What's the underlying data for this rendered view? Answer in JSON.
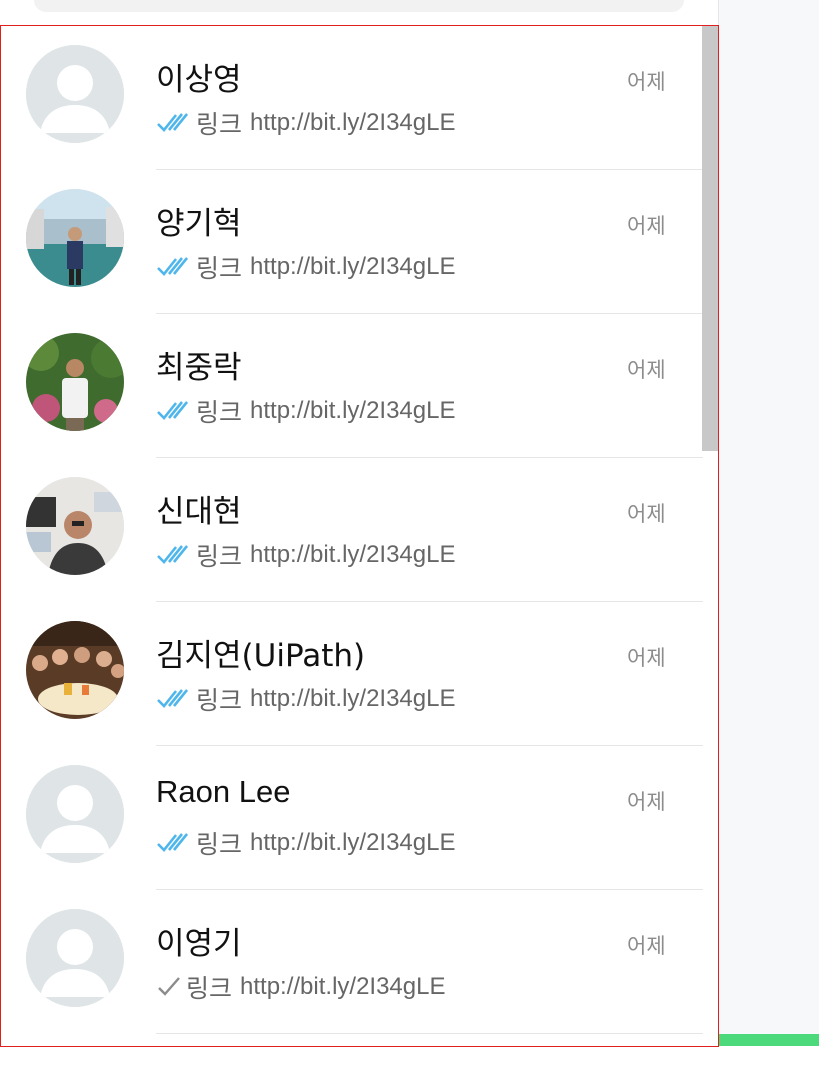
{
  "chat_list": {
    "items": [
      {
        "name": "이상영",
        "time": "어제",
        "preview_label": "링크",
        "preview_url": "http://bit.ly/2I34gLE",
        "status": "read",
        "avatar": "default-avatar"
      },
      {
        "name": "양기혁",
        "time": "어제",
        "preview_label": "링크",
        "preview_url": "http://bit.ly/2I34gLE",
        "status": "read",
        "avatar": "photo-avatar"
      },
      {
        "name": "최중락",
        "time": "어제",
        "preview_label": "링크",
        "preview_url": "http://bit.ly/2I34gLE",
        "status": "read",
        "avatar": "photo-avatar"
      },
      {
        "name": "신대현",
        "time": "어제",
        "preview_label": "링크",
        "preview_url": "http://bit.ly/2I34gLE",
        "status": "read",
        "avatar": "photo-avatar"
      },
      {
        "name": "김지연(UiPath)",
        "time": "어제",
        "preview_label": "링크",
        "preview_url": "http://bit.ly/2I34gLE",
        "status": "read",
        "avatar": "photo-avatar"
      },
      {
        "name": "Raon Lee",
        "time": "어제",
        "preview_label": "링크",
        "preview_url": "http://bit.ly/2I34gLE",
        "status": "read",
        "avatar": "default-avatar"
      },
      {
        "name": "이영기",
        "time": "어제",
        "preview_label": "링크",
        "preview_url": "http://bit.ly/2I34gLE",
        "status": "sent",
        "avatar": "default-avatar"
      }
    ]
  },
  "colors": {
    "read_tick": "#4fb6ec",
    "sent_tick": "#8c8c8c",
    "selection_border": "#e0201f",
    "accent_green": "#4cd97b"
  }
}
